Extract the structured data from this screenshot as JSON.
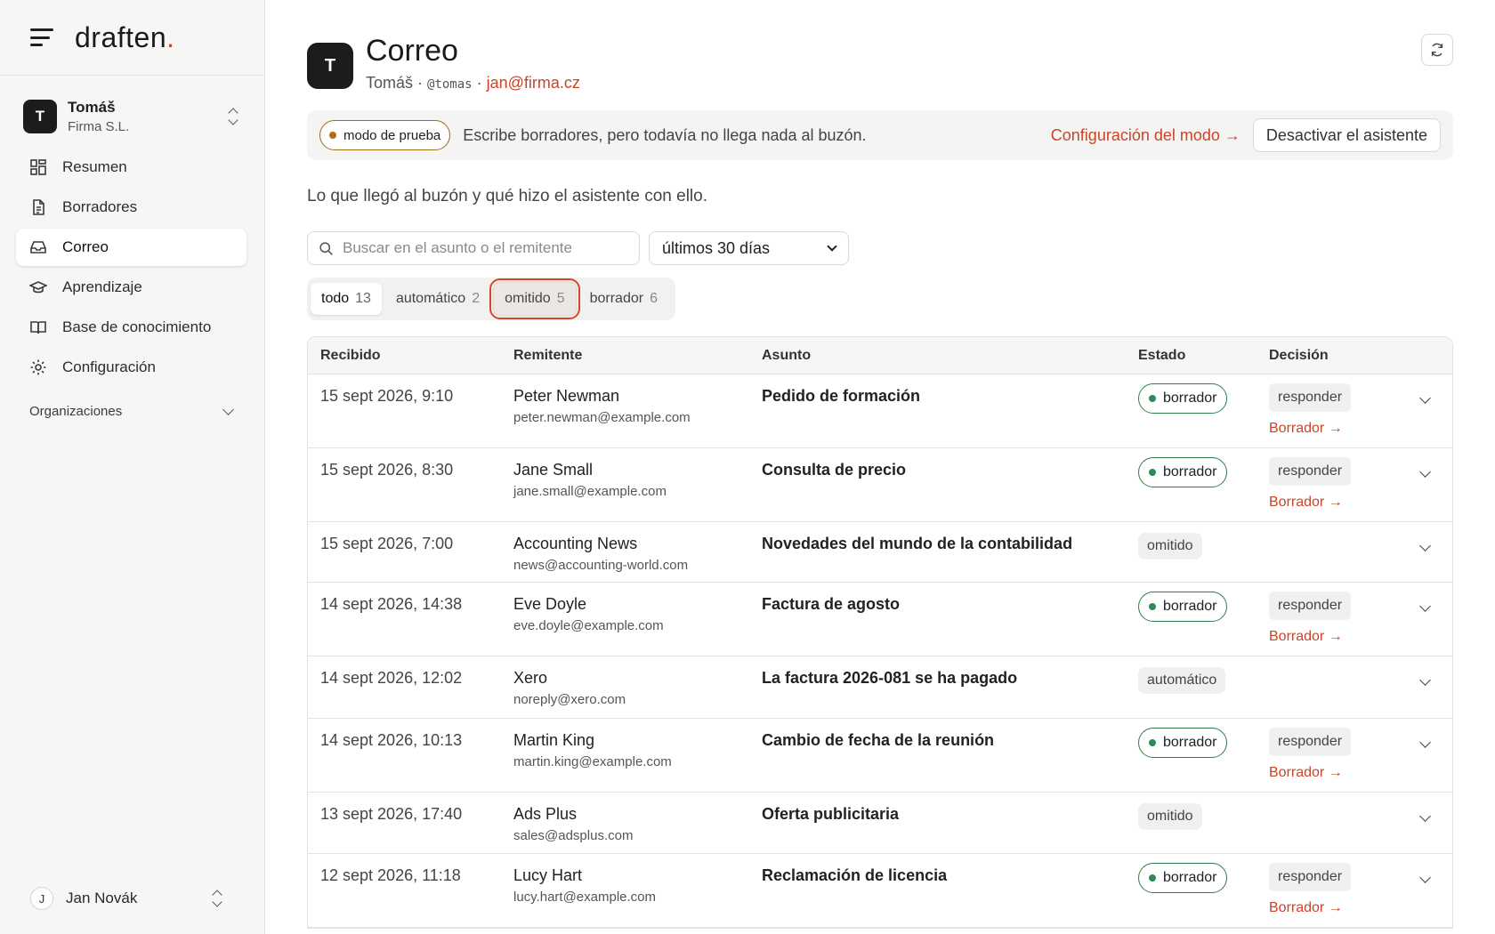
{
  "brand": {
    "name": "draften",
    "dot": "."
  },
  "account": {
    "initial": "T",
    "name": "Tomáš",
    "company": "Firma S.L."
  },
  "nav": [
    {
      "label": "Resumen",
      "icon": "grid-icon"
    },
    {
      "label": "Borradores",
      "icon": "document-icon"
    },
    {
      "label": "Correo",
      "icon": "inbox-icon",
      "active": true
    },
    {
      "label": "Aprendizaje",
      "icon": "graduation-cap-icon"
    },
    {
      "label": "Base de conocimiento",
      "icon": "book-icon"
    },
    {
      "label": "Configuración",
      "icon": "gear-icon"
    }
  ],
  "organizations_label": "Organizaciones",
  "user": {
    "initial": "J",
    "name": "Jan Novák"
  },
  "header": {
    "initial": "T",
    "title": "Correo",
    "name": "Tomáš",
    "sep1": " · ",
    "handle": "@tomas",
    "sep2": " · ",
    "email": "jan@firma.cz"
  },
  "banner": {
    "mode": "modo de prueba",
    "message": "Escribe borradores, pero todavía no llega nada al buzón.",
    "config_link": "Configuración del modo →",
    "disable_button": "Desactivar el asistente"
  },
  "intro": "Lo que llegó al buzón y qué hizo el asistente con ello.",
  "search": {
    "placeholder": "Buscar en el asunto o el remitente"
  },
  "period": {
    "selected": "últimos 30 días"
  },
  "tabs": [
    {
      "label": "todo",
      "count": "13"
    },
    {
      "label": "automático",
      "count": "2"
    },
    {
      "label": "omitido",
      "count": "5"
    },
    {
      "label": "borrador",
      "count": "6"
    }
  ],
  "table": {
    "columns": [
      "Recibido",
      "Remitente",
      "Asunto",
      "Estado",
      "Decisión"
    ],
    "rows": [
      {
        "received": "15 sept 2026, 9:10",
        "sender": "Peter Newman",
        "email": "peter.newman@example.com",
        "subject": "Pedido de formación",
        "status": "borrador",
        "decision": "responder",
        "link": "Borrador →"
      },
      {
        "received": "15 sept 2026, 8:30",
        "sender": "Jane Small",
        "email": "jane.small@example.com",
        "subject": "Consulta de precio",
        "status": "borrador",
        "decision": "responder",
        "link": "Borrador →"
      },
      {
        "received": "15 sept 2026, 7:00",
        "sender": "Accounting News",
        "email": "news@accounting-world.com",
        "subject": "Novedades del mundo de la contabilidad",
        "status": "omitido",
        "decision": "",
        "link": ""
      },
      {
        "received": "14 sept 2026, 14:38",
        "sender": "Eve Doyle",
        "email": "eve.doyle@example.com",
        "subject": "Factura de agosto",
        "status": "borrador",
        "decision": "responder",
        "link": "Borrador →"
      },
      {
        "received": "14 sept 2026, 12:02",
        "sender": "Xero",
        "email": "noreply@xero.com",
        "subject": "La factura 2026-081 se ha pagado",
        "status": "automático",
        "decision": "",
        "link": ""
      },
      {
        "received": "14 sept 2026, 10:13",
        "sender": "Martin King",
        "email": "martin.king@example.com",
        "subject": "Cambio de fecha de la reunión",
        "status": "borrador",
        "decision": "responder",
        "link": "Borrador →"
      },
      {
        "received": "13 sept 2026, 17:40",
        "sender": "Ads Plus",
        "email": "sales@adsplus.com",
        "subject": "Oferta publicitaria",
        "status": "omitido",
        "decision": "",
        "link": ""
      },
      {
        "received": "12 sept 2026, 11:18",
        "sender": "Lucy Hart",
        "email": "lucy.hart@example.com",
        "subject": "Reclamación de licencia",
        "status": "borrador",
        "decision": "responder",
        "link": "Borrador →"
      }
    ]
  },
  "colors": {
    "accent": "#c8452a",
    "draft_green": "#2e7d4f",
    "test_mode": "#b26f10"
  }
}
